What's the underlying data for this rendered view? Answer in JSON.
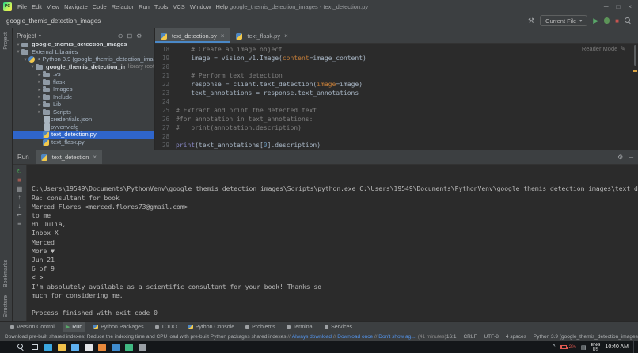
{
  "window": {
    "title": "google_themis_detection_images - text_detection.py"
  },
  "menu_bar": {
    "items": [
      "File",
      "Edit",
      "View",
      "Navigate",
      "Code",
      "Refactor",
      "Run",
      "Tools",
      "VCS",
      "Window",
      "Help"
    ]
  },
  "nav_bar": {
    "breadcrumb": "google_themis_detection_images",
    "run_config": "Current File"
  },
  "tool_strips": {
    "top": [
      "Project"
    ],
    "bottom": [
      "Bookmarks",
      "Structure"
    ]
  },
  "project_panel": {
    "title": "Project",
    "items": [
      {
        "label": "google_themis_detection_images",
        "indent": 0,
        "icon": "project-folder",
        "chevron": "down",
        "bold": true,
        "clipped": true
      },
      {
        "label": "External Libraries",
        "indent": 0,
        "icon": "libraries-folder",
        "chevron": "down"
      },
      {
        "label": "< Python 3.9 (google_themis_detection_images) >",
        "indent": 1,
        "icon": "python-sdk",
        "chevron": "down"
      },
      {
        "label": "google_themis_detection_images",
        "suffix": "library root",
        "indent": 2,
        "icon": "folder",
        "chevron": "down",
        "bold": true
      },
      {
        "label": ".vs",
        "indent": 3,
        "icon": "folder",
        "chevron": "right"
      },
      {
        "label": "flask",
        "indent": 3,
        "icon": "folder",
        "chevron": "right"
      },
      {
        "label": "Images",
        "indent": 3,
        "icon": "folder",
        "chevron": "right"
      },
      {
        "label": "Include",
        "indent": 3,
        "icon": "folder",
        "chevron": "right"
      },
      {
        "label": "Lib",
        "indent": 3,
        "icon": "folder",
        "chevron": "right"
      },
      {
        "label": "Scripts",
        "indent": 3,
        "icon": "folder",
        "chevron": "right"
      },
      {
        "label": "credentials.json",
        "indent": 3,
        "icon": "json-file"
      },
      {
        "label": "pyvenv.cfg",
        "indent": 3,
        "icon": "config-file"
      },
      {
        "label": "text_detection.py",
        "indent": 3,
        "icon": "python-file",
        "selected": true
      },
      {
        "label": "text_flask.py",
        "indent": 3,
        "icon": "python-file"
      }
    ]
  },
  "editor": {
    "tabs": [
      {
        "label": "text_detection.py",
        "active": true
      },
      {
        "label": "text_flask.py",
        "active": false
      }
    ],
    "reader_mode_label": "Reader Mode",
    "code_lines": [
      {
        "no": "18",
        "segments": [
          {
            "style": "comment",
            "text": "    # Create an image object"
          }
        ]
      },
      {
        "no": "19",
        "segments": [
          {
            "style": "plain",
            "text": "    image = vision_v1.Image("
          },
          {
            "style": "kwarg",
            "text": "content"
          },
          {
            "style": "plain",
            "text": "=image_content)"
          }
        ]
      },
      {
        "no": "20",
        "segments": []
      },
      {
        "no": "21",
        "segments": [
          {
            "style": "comment",
            "text": "    # Perform text detection"
          }
        ]
      },
      {
        "no": "22",
        "segments": [
          {
            "style": "plain",
            "text": "    response = client.text_detection("
          },
          {
            "style": "kwarg",
            "text": "image"
          },
          {
            "style": "plain",
            "text": "=image)"
          }
        ]
      },
      {
        "no": "23",
        "segments": [
          {
            "style": "plain",
            "text": "    text_annotations = response.text_annotations"
          }
        ]
      },
      {
        "no": "24",
        "segments": []
      },
      {
        "no": "25",
        "segments": [
          {
            "style": "comment",
            "text": "# Extract and print the detected text"
          }
        ]
      },
      {
        "no": "26",
        "segments": [
          {
            "style": "comment",
            "text": "#for annotation in text_annotations:"
          }
        ]
      },
      {
        "no": "27",
        "segments": [
          {
            "style": "comment",
            "text": "#   print(annotation.description)"
          }
        ]
      },
      {
        "no": "28",
        "segments": []
      },
      {
        "no": "29",
        "segments": [
          {
            "style": "builtin",
            "text": "print"
          },
          {
            "style": "plain",
            "text": "(text_annotations["
          },
          {
            "style": "number",
            "text": "0"
          },
          {
            "style": "plain",
            "text": "].description)"
          }
        ]
      }
    ]
  },
  "run_panel": {
    "title": "Run",
    "tab_label": "text_detection",
    "toolbar_icons": [
      {
        "name": "rerun",
        "glyph": "↻",
        "color": "#499c54"
      },
      {
        "name": "stop",
        "glyph": "■",
        "color": "#9e5a52"
      },
      {
        "name": "restore-layout",
        "glyph": "▦",
        "color": "#9da0a3"
      },
      {
        "name": "prev-occurrence",
        "glyph": "↑",
        "color": "#9da0a3"
      },
      {
        "name": "next-occurrence",
        "glyph": "↓",
        "color": "#9da0a3"
      },
      {
        "name": "soft-wrap",
        "glyph": "↩",
        "color": "#9da0a3"
      },
      {
        "name": "scroll-to-end",
        "glyph": "≡",
        "color": "#9da0a3"
      }
    ],
    "console_lines": [
      "C:\\Users\\19549\\Documents\\PythonVenv\\google_themis_detection_images\\Scripts\\python.exe C:\\Users\\19549\\Documents\\PythonVenv\\google_themis_detection_images\\text_detection.py",
      "Re: consultant for book",
      "Merced Flores <merced.flores73@gmail.com>",
      "to me",
      "Hi Julia,",
      "Inbox X",
      "Merced",
      "More ▼",
      "Jun 21",
      "6 of 9",
      "< >",
      "I'm absolutely available as a scientific consultant for your book! Thanks so",
      "much for considering me.",
      "",
      "Process finished with exit code 0"
    ]
  },
  "tool_window_bar": {
    "items": [
      {
        "label": "Version Control",
        "icon": "version-control"
      },
      {
        "label": "Run",
        "icon": "run",
        "active": true
      },
      {
        "label": "Python Packages",
        "icon": "python-packages"
      },
      {
        "label": "TODO",
        "icon": "todo"
      },
      {
        "label": "Python Console",
        "icon": "python-console"
      },
      {
        "label": "Problems",
        "icon": "problems"
      },
      {
        "label": "Terminal",
        "icon": "terminal"
      },
      {
        "label": "Services",
        "icon": "services"
      }
    ]
  },
  "status_bar": {
    "message": "Download pre-built shared indexes: Reduce the indexing time and CPU load with pre-built Python packages shared indexes",
    "links": [
      "Always download",
      "Download once",
      "Don't show ag..."
    ],
    "duration": "(41 minutes)",
    "right_items": [
      "16:1",
      "CRLF",
      "UTF-8",
      "4 spaces",
      "Python 3.9 (google_themis_detection_images)"
    ]
  },
  "taskbar": {
    "icons": [
      {
        "name": "start",
        "color": "#cfd6dc"
      },
      {
        "name": "search",
        "color": "#cfd6dc"
      },
      {
        "name": "task-view",
        "color": "#cfd6dc"
      },
      {
        "name": "app-edge",
        "color": "#3ba7e0"
      },
      {
        "name": "app-file-explorer",
        "color": "#f0c04a"
      },
      {
        "name": "app-store",
        "color": "#5fb2f2"
      },
      {
        "name": "app-chrome",
        "color": "#e3e5e8"
      },
      {
        "name": "app-firefox",
        "color": "#e98a3c"
      },
      {
        "name": "app-outlook",
        "color": "#3f8cce"
      },
      {
        "name": "app-pycharm",
        "color": "#40b983"
      },
      {
        "name": "app-misc",
        "color": "#9aa0a6"
      }
    ],
    "tray": {
      "battery": "2%",
      "lang": "ENG",
      "region": "US",
      "time": "10:40 AM"
    }
  }
}
